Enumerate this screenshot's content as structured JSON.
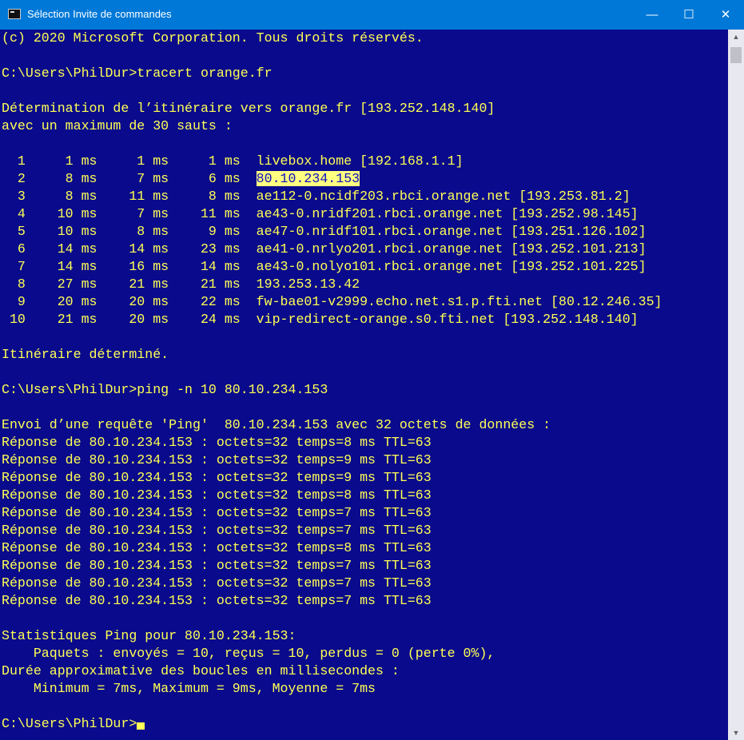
{
  "window": {
    "title": "Sélection Invite de commandes",
    "minimize": "—",
    "maximize": "☐",
    "close": "✕"
  },
  "terminal": {
    "lines": [
      "(c) 2020 Microsoft Corporation. Tous droits réservés.",
      "",
      "C:\\Users\\PhilDur>tracert orange.fr",
      "",
      "Détermination de l’itinéraire vers orange.fr [193.252.148.140]",
      "avec un maximum de 30 sauts :",
      "",
      "  1     1 ms     1 ms     1 ms  livebox.home [192.168.1.1]",
      "",
      "  3     8 ms    11 ms     8 ms  ae112-0.ncidf203.rbci.orange.net [193.253.81.2]",
      "  4    10 ms     7 ms    11 ms  ae43-0.nridf201.rbci.orange.net [193.252.98.145]",
      "  5    10 ms     8 ms     9 ms  ae47-0.nridf101.rbci.orange.net [193.251.126.102]",
      "  6    14 ms    14 ms    23 ms  ae41-0.nrlyo201.rbci.orange.net [193.252.101.213]",
      "  7    14 ms    16 ms    14 ms  ae43-0.nolyo101.rbci.orange.net [193.252.101.225]",
      "  8    27 ms    21 ms    21 ms  193.253.13.42",
      "  9    20 ms    20 ms    22 ms  fw-bae01-v2999.echo.net.s1.p.fti.net [80.12.246.35]",
      " 10    21 ms    20 ms    24 ms  vip-redirect-orange.s0.fti.net [193.252.148.140]",
      "",
      "Itinéraire déterminé.",
      "",
      "C:\\Users\\PhilDur>ping -n 10 80.10.234.153",
      "",
      "Envoi d’une requête 'Ping'  80.10.234.153 avec 32 octets de données :",
      "Réponse de 80.10.234.153 : octets=32 temps=8 ms TTL=63",
      "Réponse de 80.10.234.153 : octets=32 temps=9 ms TTL=63",
      "Réponse de 80.10.234.153 : octets=32 temps=9 ms TTL=63",
      "Réponse de 80.10.234.153 : octets=32 temps=8 ms TTL=63",
      "Réponse de 80.10.234.153 : octets=32 temps=7 ms TTL=63",
      "Réponse de 80.10.234.153 : octets=32 temps=7 ms TTL=63",
      "Réponse de 80.10.234.153 : octets=32 temps=8 ms TTL=63",
      "Réponse de 80.10.234.153 : octets=32 temps=7 ms TTL=63",
      "Réponse de 80.10.234.153 : octets=32 temps=7 ms TTL=63",
      "Réponse de 80.10.234.153 : octets=32 temps=7 ms TTL=63",
      "",
      "Statistiques Ping pour 80.10.234.153:",
      "    Paquets : envoyés = 10, reçus = 10, perdus = 0 (perte 0%),",
      "Durée approximative des boucles en millisecondes :",
      "    Minimum = 7ms, Maximum = 9ms, Moyenne = 7ms",
      "",
      "C:\\Users\\PhilDur>"
    ],
    "hop2_prefix": "  2     8 ms     7 ms     6 ms  ",
    "hop2_selected": "80.10.234.153"
  },
  "colors": {
    "background": "#0a0a8c",
    "text": "#ffff55",
    "titlebar": "#0078d7"
  }
}
